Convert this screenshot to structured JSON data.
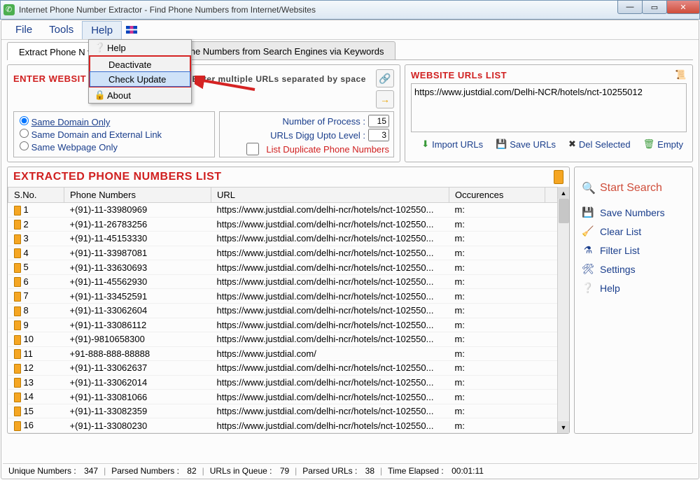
{
  "window": {
    "title": "Internet Phone Number Extractor - Find Phone Numbers from Internet/Websites"
  },
  "menu": {
    "file": "File",
    "tools": "Tools",
    "help": "Help"
  },
  "help_menu": {
    "help": "Help",
    "deactivate": "Deactivate",
    "check_update": "Check Update",
    "about": "About"
  },
  "tabs": {
    "url": "Extract Phone N                                 via URL",
    "keywords": "Extract Phone Numbers from Search Engines via Keywords"
  },
  "enter_panel": {
    "title": "ENTER WEBSIT",
    "hint": "Enter multiple URLs separated by space"
  },
  "opts": {
    "same_domain": "Same Domain Only",
    "same_ext": "Same Domain and External Link",
    "same_page": "Same Webpage Only",
    "num_process_label": "Number of Process :",
    "num_process": "15",
    "digg_label": "URLs Digg Upto Level :",
    "digg": "3",
    "dup": "List Duplicate Phone Numbers"
  },
  "urls_panel": {
    "title": "WEBSITE URLs LIST",
    "items": [
      "https://www.justdial.com/Delhi-NCR/hotels/nct-10255012"
    ],
    "actions": {
      "import": "Import URLs",
      "save": "Save URLs",
      "del": "Del Selected",
      "empty": "Empty"
    }
  },
  "extracted": {
    "title": "EXTRACTED PHONE NUMBERS LIST",
    "cols": {
      "sno": "S.No.",
      "phone": "Phone Numbers",
      "url": "URL",
      "occ": "Occurences"
    },
    "rows": [
      {
        "n": "1",
        "phone": "+(91)-11-33980969",
        "url": "https://www.justdial.com/delhi-ncr/hotels/nct-102550...",
        "occ": "m:"
      },
      {
        "n": "2",
        "phone": "+(91)-11-26783256",
        "url": "https://www.justdial.com/delhi-ncr/hotels/nct-102550...",
        "occ": "m:"
      },
      {
        "n": "3",
        "phone": "+(91)-11-45153330",
        "url": "https://www.justdial.com/delhi-ncr/hotels/nct-102550...",
        "occ": "m:"
      },
      {
        "n": "4",
        "phone": "+(91)-11-33987081",
        "url": "https://www.justdial.com/delhi-ncr/hotels/nct-102550...",
        "occ": "m:"
      },
      {
        "n": "5",
        "phone": "+(91)-11-33630693",
        "url": "https://www.justdial.com/delhi-ncr/hotels/nct-102550...",
        "occ": "m:"
      },
      {
        "n": "6",
        "phone": "+(91)-11-45562930",
        "url": "https://www.justdial.com/delhi-ncr/hotels/nct-102550...",
        "occ": "m:"
      },
      {
        "n": "7",
        "phone": "+(91)-11-33452591",
        "url": "https://www.justdial.com/delhi-ncr/hotels/nct-102550...",
        "occ": "m:"
      },
      {
        "n": "8",
        "phone": "+(91)-11-33062604",
        "url": "https://www.justdial.com/delhi-ncr/hotels/nct-102550...",
        "occ": "m:"
      },
      {
        "n": "9",
        "phone": "+(91)-11-33086112",
        "url": "https://www.justdial.com/delhi-ncr/hotels/nct-102550...",
        "occ": "m:"
      },
      {
        "n": "10",
        "phone": "+(91)-9810658300",
        "url": "https://www.justdial.com/delhi-ncr/hotels/nct-102550...",
        "occ": "m:"
      },
      {
        "n": "11",
        "phone": "+91-888-888-88888",
        "url": "https://www.justdial.com/",
        "occ": "m:"
      },
      {
        "n": "12",
        "phone": "+(91)-11-33062637",
        "url": "https://www.justdial.com/delhi-ncr/hotels/nct-102550...",
        "occ": "m:"
      },
      {
        "n": "13",
        "phone": "+(91)-11-33062014",
        "url": "https://www.justdial.com/delhi-ncr/hotels/nct-102550...",
        "occ": "m:"
      },
      {
        "n": "14",
        "phone": "+(91)-11-33081066",
        "url": "https://www.justdial.com/delhi-ncr/hotels/nct-102550...",
        "occ": "m:"
      },
      {
        "n": "15",
        "phone": "+(91)-11-33082359",
        "url": "https://www.justdial.com/delhi-ncr/hotels/nct-102550...",
        "occ": "m:"
      },
      {
        "n": "16",
        "phone": "+(91)-11-33080230",
        "url": "https://www.justdial.com/delhi-ncr/hotels/nct-102550...",
        "occ": "m:"
      }
    ]
  },
  "side": {
    "start": "Start Search",
    "save": "Save Numbers",
    "clear": "Clear List",
    "filter": "Filter List",
    "settings": "Settings",
    "help": "Help"
  },
  "status": {
    "unique_label": "Unique Numbers :",
    "unique": "347",
    "parsed_label": "Parsed Numbers :",
    "parsed": "82",
    "queue_label": "URLs in Queue :",
    "queue": "79",
    "purls_label": "Parsed URLs :",
    "purls": "38",
    "time_label": "Time Elapsed :",
    "time": "00:01:11"
  }
}
